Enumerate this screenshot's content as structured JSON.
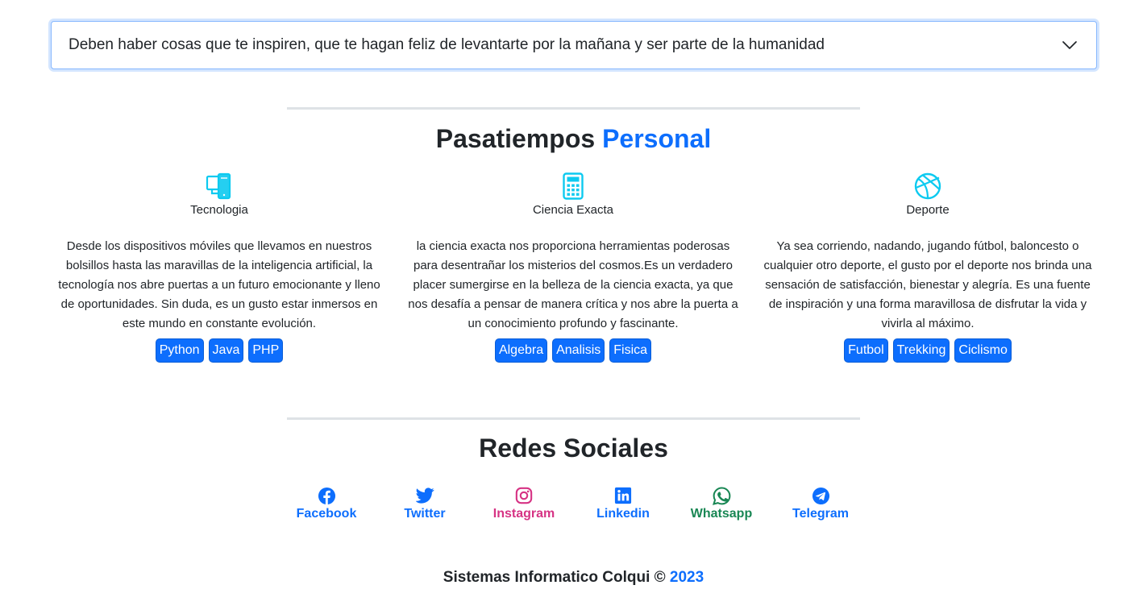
{
  "accordion": {
    "text": "Deben haber cosas que te inspiren, que te hagan feliz de levantarte por la mañana y ser parte de la humanidad",
    "icon": "chevron-down-icon"
  },
  "hobbies_section": {
    "title_main": "Pasatiempos",
    "title_accent": "Personal",
    "items": [
      {
        "icon": "devices-icon",
        "name": "Tecnologia",
        "description": "Desde los dispositivos móviles que llevamos en nuestros bolsillos hasta las maravillas de la inteligencia artificial, la tecnología nos abre puertas a un futuro emocionante y lleno de oportunidades. Sin duda, es un gusto estar inmersos en este mundo en constante evolución.",
        "tags": [
          "Python",
          "Java",
          "PHP"
        ]
      },
      {
        "icon": "calculator-icon",
        "name": "Ciencia Exacta",
        "description": "la ciencia exacta nos proporciona herramientas poderosas para desentrañar los misterios del cosmos.Es un verdadero placer sumergirse en la belleza de la ciencia exacta, ya que nos desafía a pensar de manera crítica y nos abre la puerta a un conocimiento profundo y fascinante.",
        "tags": [
          "Algebra",
          "Analisis",
          "Fisica"
        ]
      },
      {
        "icon": "basketball-icon",
        "name": "Deporte",
        "description": "Ya sea corriendo, nadando, jugando fútbol, baloncesto o cualquier otro deporte, el gusto por el deporte nos brinda una sensación de satisfacción, bienestar y alegría. Es una fuente de inspiración y una forma maravillosa de disfrutar la vida y vivirla al máximo.",
        "tags": [
          "Futbol",
          "Trekking",
          "Ciclismo"
        ]
      }
    ]
  },
  "social_section": {
    "title": "Redes Sociales",
    "items": [
      {
        "label": "Facebook",
        "icon": "facebook-icon",
        "color": "#0d6efd"
      },
      {
        "label": "Twitter",
        "icon": "twitter-icon",
        "color": "#0d6efd"
      },
      {
        "label": "Instagram",
        "icon": "instagram-icon",
        "color": "#d63384"
      },
      {
        "label": "Linkedin",
        "icon": "linkedin-icon",
        "color": "#0d6efd"
      },
      {
        "label": "Whatsapp",
        "icon": "whatsapp-icon",
        "color": "#198754"
      },
      {
        "label": "Telegram",
        "icon": "telegram-icon",
        "color": "#0d6efd"
      }
    ]
  },
  "footer": {
    "text": "Sistemas Informatico Colqui ©",
    "year": "2023"
  },
  "colors": {
    "accent": "#0d6efd",
    "icon_cyan": "#0dcaf0",
    "text": "#212529"
  }
}
